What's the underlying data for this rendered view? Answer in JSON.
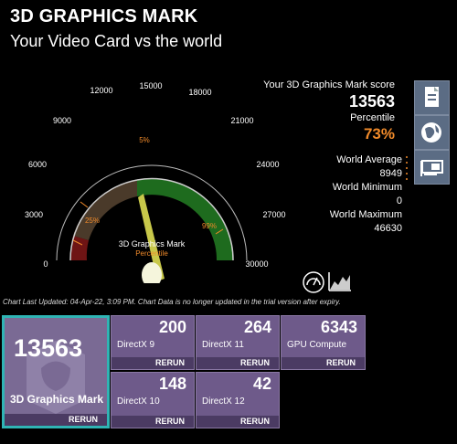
{
  "header": {
    "title": "3D GRAPHICS MARK",
    "subtitle": "Your Video Card vs the world"
  },
  "gauge": {
    "ticks": [
      "0",
      "3000",
      "6000",
      "9000",
      "12000",
      "15000",
      "18000",
      "21000",
      "24000",
      "27000",
      "30000"
    ],
    "center_label": "3D Graphics Mark",
    "center_sublabel": "Percentile",
    "pct_25": "25%",
    "pct_50": "5%",
    "pct_99": "99%",
    "needle_value": 13563,
    "max": 30000
  },
  "score": {
    "label": "Your 3D Graphics Mark score",
    "value": "13563",
    "percentile_label": "Percentile",
    "percentile": "73%"
  },
  "stats": {
    "world_average_label": "World Average",
    "world_average": "8949",
    "world_minimum_label": "World Minimum",
    "world_minimum": "0",
    "world_maximum_label": "World Maximum",
    "world_maximum": "46630"
  },
  "footnote": "Chart Last Updated: 04-Apr-22, 3:09 PM. Chart Data is no longer updated in the trial version after expiry.",
  "tiles": {
    "main": {
      "value": "13563",
      "label": "3D Graphics Mark",
      "rerun": "RERUN"
    },
    "dx9": {
      "value": "200",
      "label": "DirectX 9",
      "rerun": "RERUN"
    },
    "dx11": {
      "value": "264",
      "label": "DirectX 11",
      "rerun": "RERUN"
    },
    "gpu": {
      "value": "6343",
      "label": "GPU Compute",
      "rerun": "RERUN"
    },
    "dx10": {
      "value": "148",
      "label": "DirectX 10",
      "rerun": "RERUN"
    },
    "dx12": {
      "value": "42",
      "label": "DirectX 12",
      "rerun": "RERUN"
    }
  },
  "colors": {
    "accent": "#f08a2a",
    "tile": "#6e5a8a",
    "highlight": "#2fb4b4",
    "gauge_green": "#1e6b1e",
    "gauge_brown": "#4a3a2a",
    "gauge_red": "#6e1414"
  },
  "icons": [
    "document-icon",
    "globe-icon",
    "gpu-card-icon",
    "gauge-icon",
    "chart-icon"
  ]
}
